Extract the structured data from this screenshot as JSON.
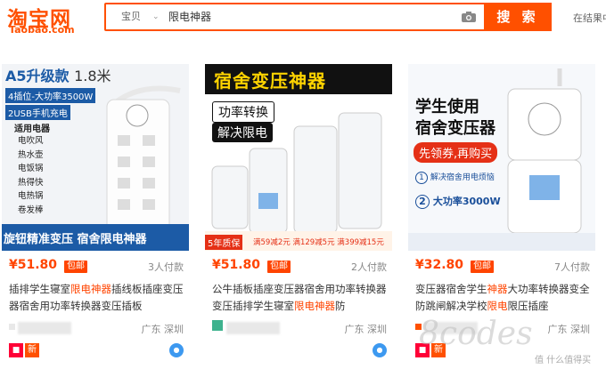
{
  "header": {
    "logo_cn": "淘宝网",
    "logo_en": "Taobao.com",
    "search_type": "宝贝",
    "search_query": "限电神器",
    "search_button": "搜 索",
    "right_link": "在结果中"
  },
  "cards": [
    {
      "img": {
        "headline": "A5升级款",
        "length": "1.8米",
        "tag1": "4插位-大功率3500W",
        "tag2": "2USB手机充电",
        "list_title": "适用电器",
        "list": [
          "电吹风",
          "热水壶",
          "电饭锅",
          "热得快",
          "电热锅",
          "卷发棒"
        ],
        "footer": "旋钮精准变压 宿舍限电神器"
      },
      "price": "¥51.80",
      "badge": "包邮",
      "sales": "3人付款",
      "title_pre": "插排学生寝室",
      "title_hl1": "限电神器",
      "title_mid": "插线板插座变压器宿舍用功率转换器变压插板",
      "title_hl2": "",
      "title_post": "",
      "location": "广东 深圳"
    },
    {
      "img": {
        "headline": "宿舍变压神器",
        "line1": "功率转换",
        "line2": "解决限电",
        "footer_tag": "5年质保",
        "coupons": [
          "满59减2元",
          "满129减5元",
          "满399减15元"
        ]
      },
      "price": "¥51.80",
      "badge": "包邮",
      "sales": "2人付款",
      "title_pre": "公牛插板插座变压器宿舍用功率转换器变压插排学生寝室",
      "title_hl1": "限电神器",
      "title_mid": "防",
      "title_hl2": "",
      "title_post": "",
      "location": "广东 深圳"
    },
    {
      "img": {
        "headline1": "学生使用",
        "headline2": "宿舍变压器",
        "banner": "先领券,再购买",
        "feature1": "解决宿舍用电烦恼",
        "feature2": "大功率3000W"
      },
      "price": "¥32.80",
      "badge": "包邮",
      "sales": "7人付款",
      "title_pre": "变压器宿舍学生",
      "title_hl1": "神器",
      "title_mid": "大功率转换器变全防跳闸解决学校",
      "title_hl2": "限电",
      "title_post": "限压插座",
      "location": "广东 深圳"
    }
  ],
  "watermark": "8codes",
  "watermark_small": "值 什么值得买",
  "colors": {
    "brand": "#ff5000",
    "price": "#ff4400",
    "tmall": "#ff0036"
  }
}
